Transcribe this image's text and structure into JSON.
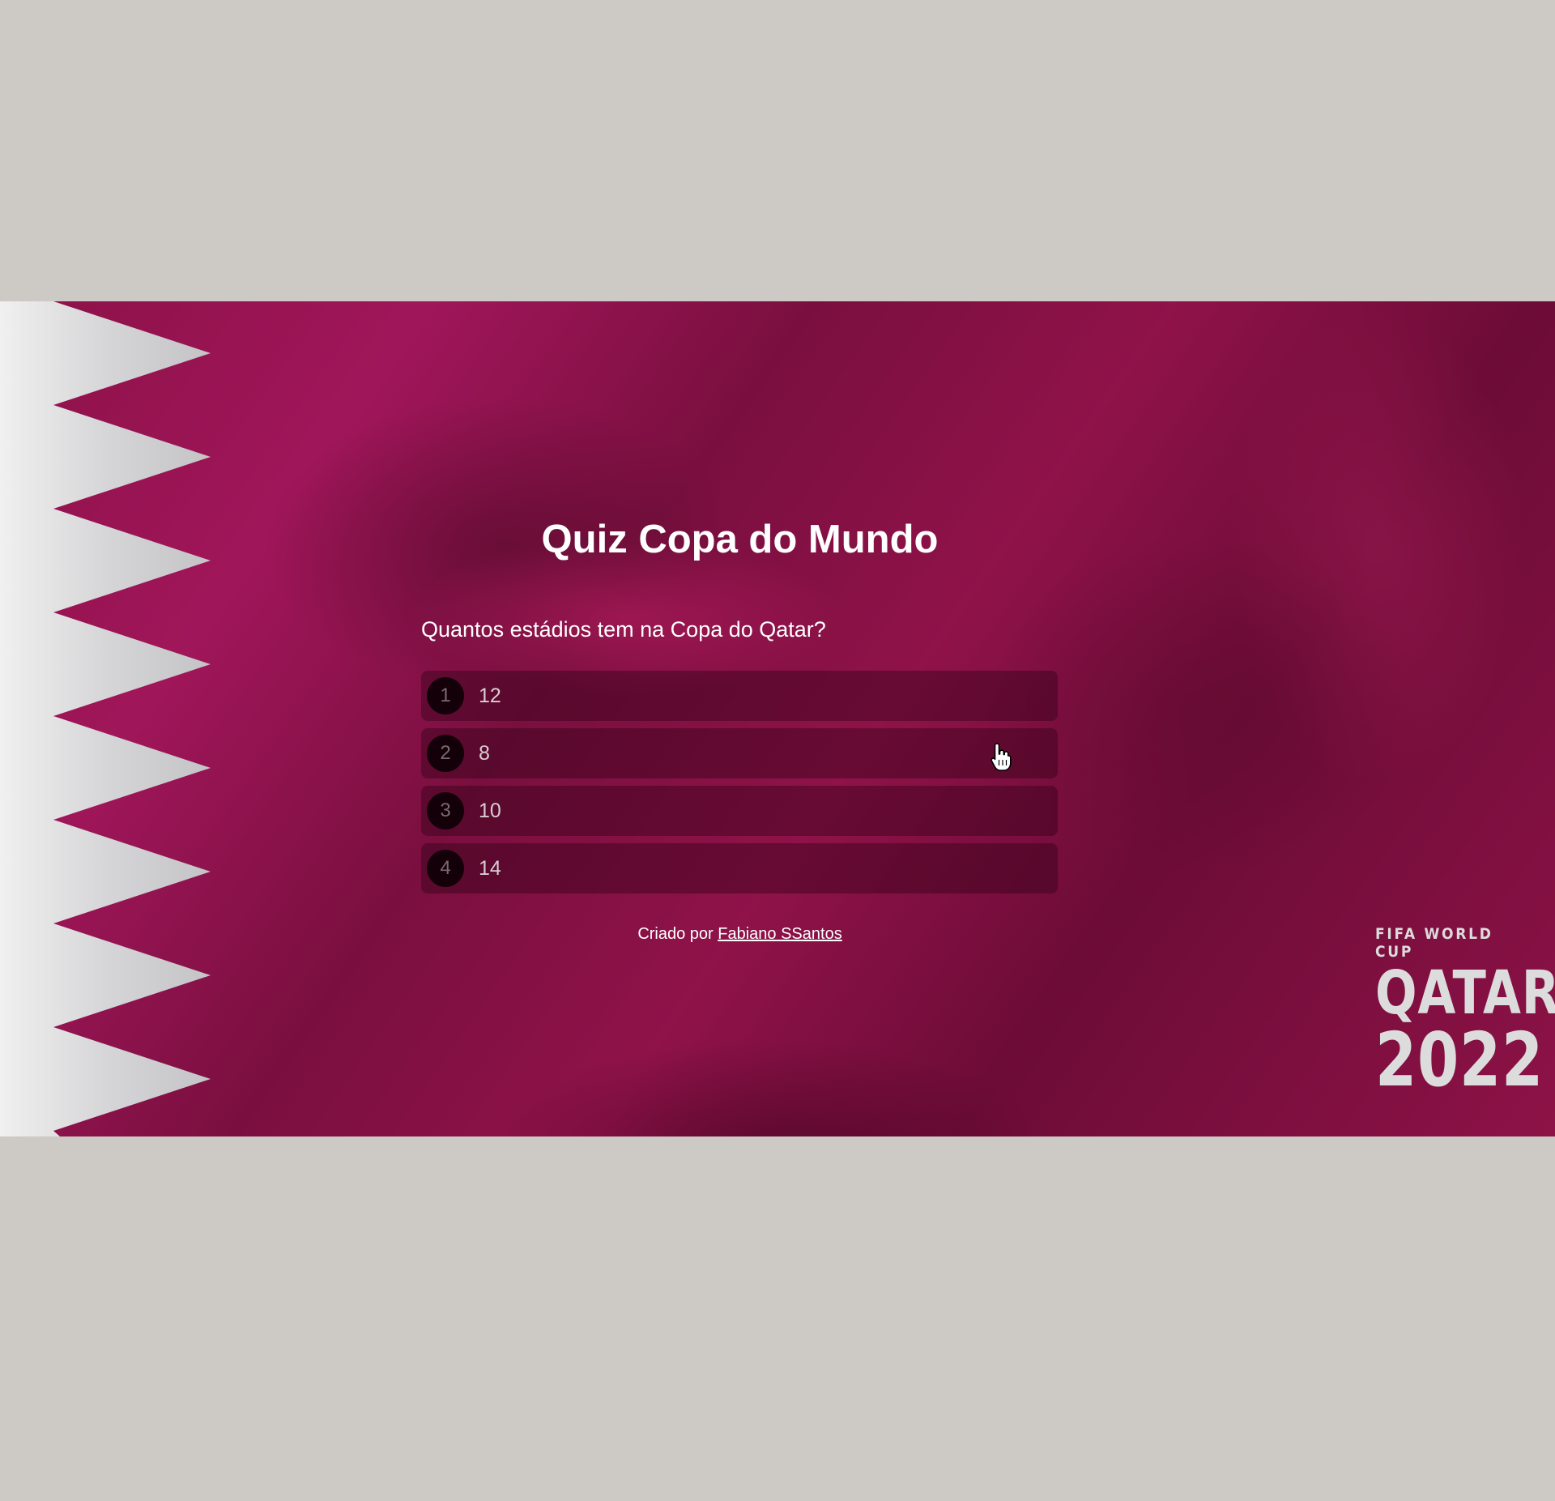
{
  "quiz": {
    "title": "Quiz Copa do Mundo",
    "question": "Quantos estádios tem na Copa do Qatar?",
    "options": [
      {
        "number": "1",
        "label": "12"
      },
      {
        "number": "2",
        "label": "8"
      },
      {
        "number": "3",
        "label": "10"
      },
      {
        "number": "4",
        "label": "14"
      }
    ]
  },
  "footer": {
    "prefix": "Criado por ",
    "author": "Fabiano SSantos"
  },
  "logo": {
    "line1": "FIFA WORLD CUP",
    "line2": "QATAR",
    "line3": "2022"
  },
  "colors": {
    "maroon": "#8a1246",
    "flag_white": "#e2e2e2",
    "outer_background": "#cdc9c5"
  },
  "icons": {
    "cursor": "hand-pointer-icon"
  }
}
